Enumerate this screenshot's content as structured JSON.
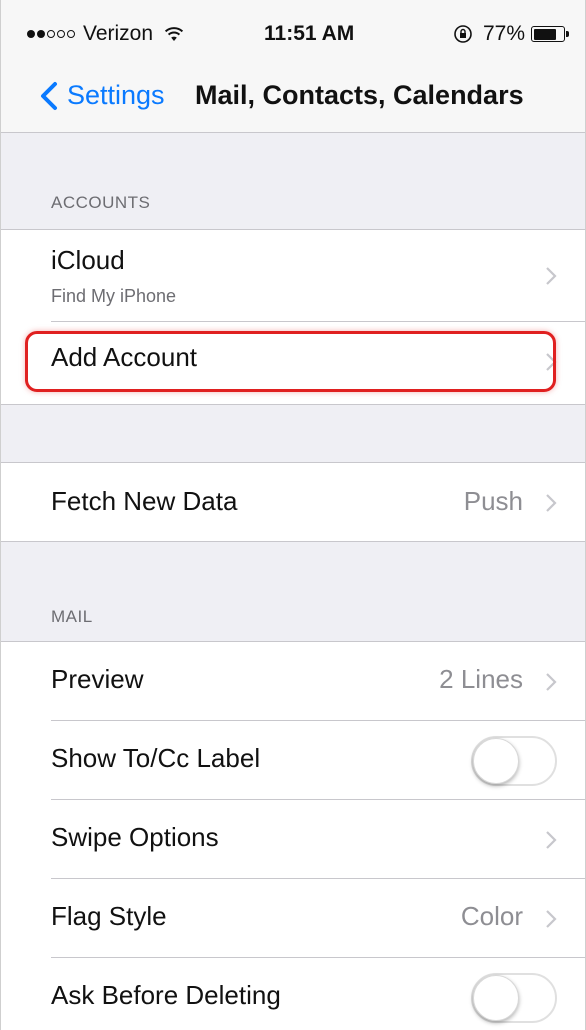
{
  "status_bar": {
    "signal_dots_filled": 2,
    "signal_dots_total": 5,
    "carrier": "Verizon",
    "time": "11:51 AM",
    "battery_percent": "77%",
    "battery_level": 0.77
  },
  "nav": {
    "back_label": "Settings",
    "title": "Mail, Contacts, Calendars"
  },
  "accounts": {
    "header": "ACCOUNTS",
    "icloud_label": "iCloud",
    "icloud_sublabel": "Find My iPhone",
    "add_account_label": "Add Account"
  },
  "fetch": {
    "label": "Fetch New Data",
    "value": "Push"
  },
  "mail": {
    "header": "MAIL",
    "preview_label": "Preview",
    "preview_value": "2 Lines",
    "show_tocc_label": "Show To/Cc Label",
    "show_tocc_on": false,
    "swipe_label": "Swipe Options",
    "flag_label": "Flag Style",
    "flag_value": "Color",
    "ask_delete_label": "Ask Before Deleting",
    "ask_delete_on": false
  },
  "colors": {
    "ios_blue": "#0a7aff",
    "highlight_red": "#e02020",
    "group_background": "#efeff4"
  },
  "icons": [
    "wifi-icon",
    "rotation-lock-icon",
    "battery-icon",
    "back-chevron-icon",
    "chevron-right-icon"
  ]
}
